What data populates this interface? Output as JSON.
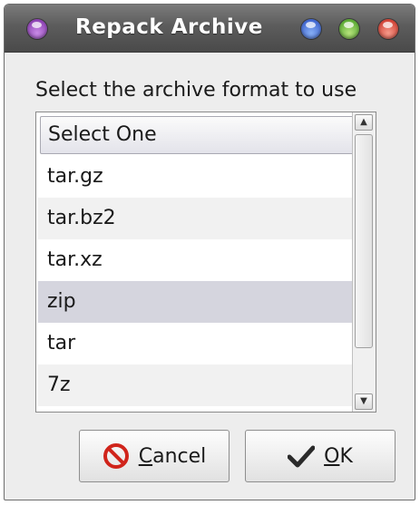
{
  "window": {
    "title": "Repack Archive",
    "controls": {
      "menu": "menu-orb",
      "minimize": "minimize-orb",
      "maximize": "maximize-orb",
      "close": "close-orb"
    }
  },
  "prompt": "Select the archive format to use",
  "list": {
    "header": "Select One",
    "items": [
      "tar.gz",
      "tar.bz2",
      "tar.xz",
      "zip",
      "tar",
      "7z"
    ],
    "selected": "zip"
  },
  "buttons": {
    "cancel": {
      "mnemonic": "C",
      "rest": "ancel",
      "icon": "cancel-icon"
    },
    "ok": {
      "mnemonic": "O",
      "rest": "K",
      "icon": "checkmark-icon"
    }
  },
  "colors": {
    "titlebar": "#5c5c5c",
    "selection": "#d5d5de",
    "cancel_icon": "#d0241b"
  }
}
